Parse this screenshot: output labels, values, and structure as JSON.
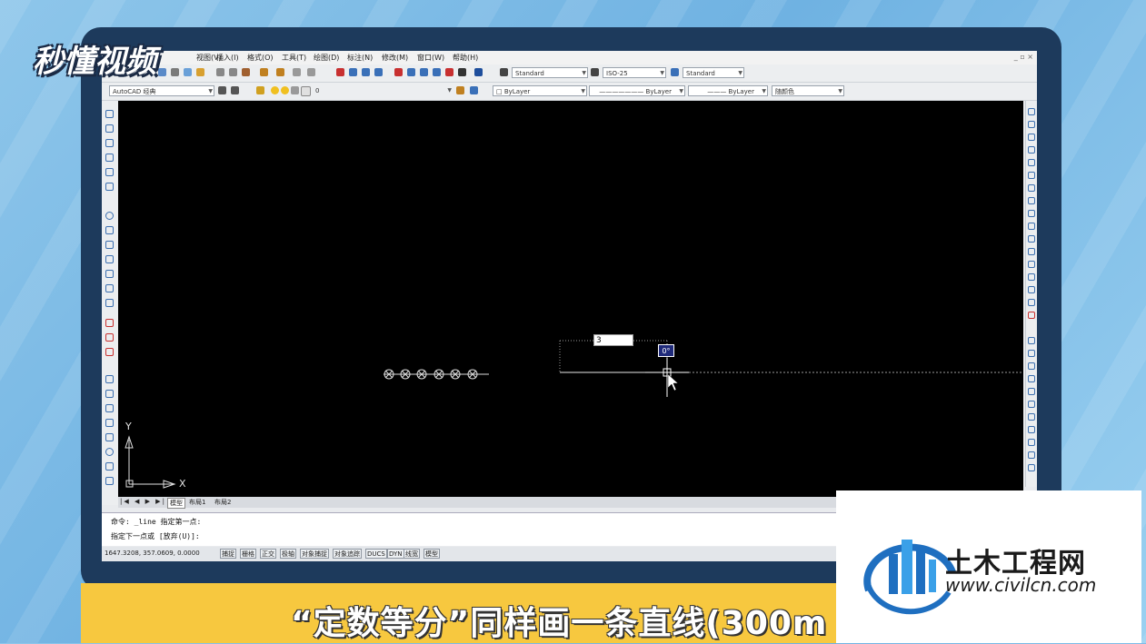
{
  "brand_logo": "秒懂视频",
  "menu": [
    "视图(V)",
    "插入(I)",
    "格式(O)",
    "工具(T)",
    "绘图(D)",
    "标注(N)",
    "修改(M)",
    "窗口(W)",
    "帮助(H)"
  ],
  "window_controls": "_ ▫ ×",
  "toolbar1": {
    "text_style": "Standard",
    "dim_style": "ISO-25",
    "table_style": "Standard"
  },
  "toolbar2": {
    "workspace": "AutoCAD 经典",
    "layer": "0",
    "color": "ByLayer",
    "linetype": "ByLayer",
    "lineweight": "ByLayer",
    "plotstyle": "随颜色"
  },
  "canvas": {
    "dyn_input_value": "3",
    "angle_tooltip": "0°",
    "ucs_x": "X",
    "ucs_y": "Y"
  },
  "tabs": [
    "模型",
    "布局1",
    "布局2"
  ],
  "command_lines": [
    "命令: _line 指定第一点:",
    "指定下一点或 [放弃(U)]:"
  ],
  "status": {
    "coords": "1647.3208, 357.0609, 0.0000",
    "buttons": [
      "捕捉",
      "栅格",
      "正交",
      "极轴",
      "对象捕捉",
      "对象追踪",
      "DUCS",
      "DYN",
      "线宽",
      "模型"
    ]
  },
  "caption": "“定数等分”同样画一条直线(300m",
  "watermark": {
    "title": "土木工程网",
    "url": "www.civilcn.com"
  },
  "colors": {
    "frame": "#1d3a5c",
    "caption_bar": "#f7c83f",
    "canvas": "#000000",
    "logo_blue": "#1f6fc0"
  }
}
